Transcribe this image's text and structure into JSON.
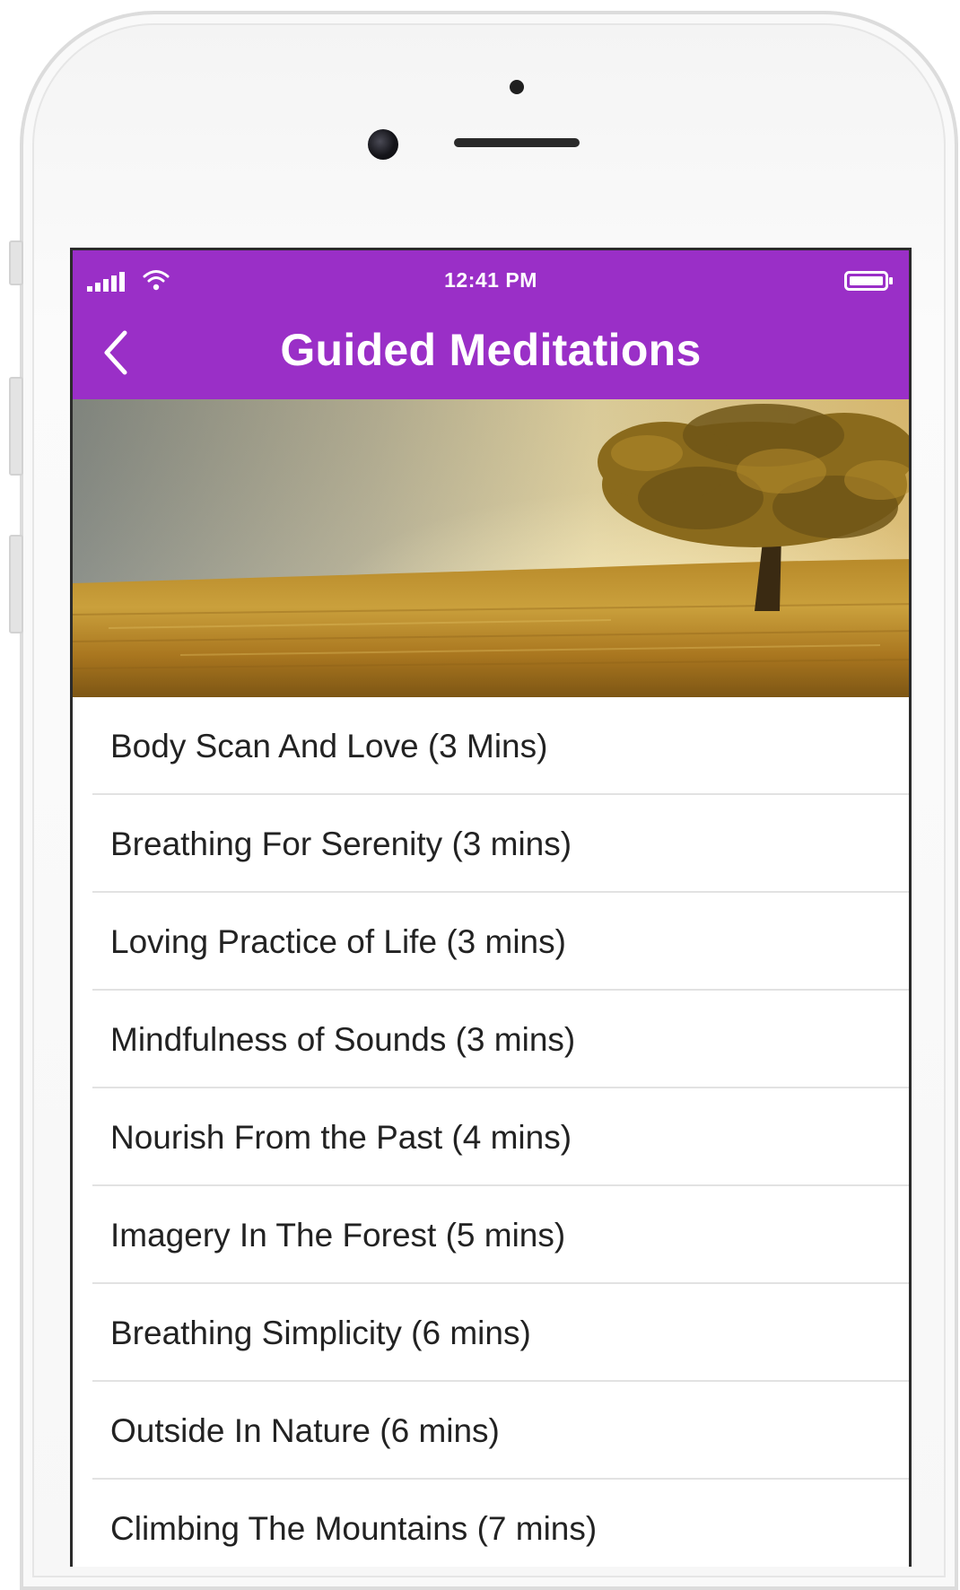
{
  "colors": {
    "accent": "#9a2fc7",
    "title_text": "#ffffff",
    "list_text": "#222222",
    "divider": "#e2e2e2"
  },
  "status_bar": {
    "time": "12:41 PM",
    "signal_icon": "signal-bars-icon",
    "wifi_icon": "wifi-icon",
    "battery_icon": "battery-icon"
  },
  "header": {
    "title": "Guided Meditations",
    "back_icon": "chevron-left-icon"
  },
  "meditations": [
    {
      "label": "Body Scan And Love (3 Mins)"
    },
    {
      "label": "Breathing For Serenity (3 mins)"
    },
    {
      "label": "Loving Practice of Life (3 mins)"
    },
    {
      "label": "Mindfulness of Sounds (3 mins)"
    },
    {
      "label": "Nourish From the Past (4 mins)"
    },
    {
      "label": "Imagery In The Forest (5 mins)"
    },
    {
      "label": "Breathing Simplicity (6 mins)"
    },
    {
      "label": "Outside In Nature (6 mins)"
    },
    {
      "label": "Climbing The Mountains (7 mins)"
    }
  ]
}
